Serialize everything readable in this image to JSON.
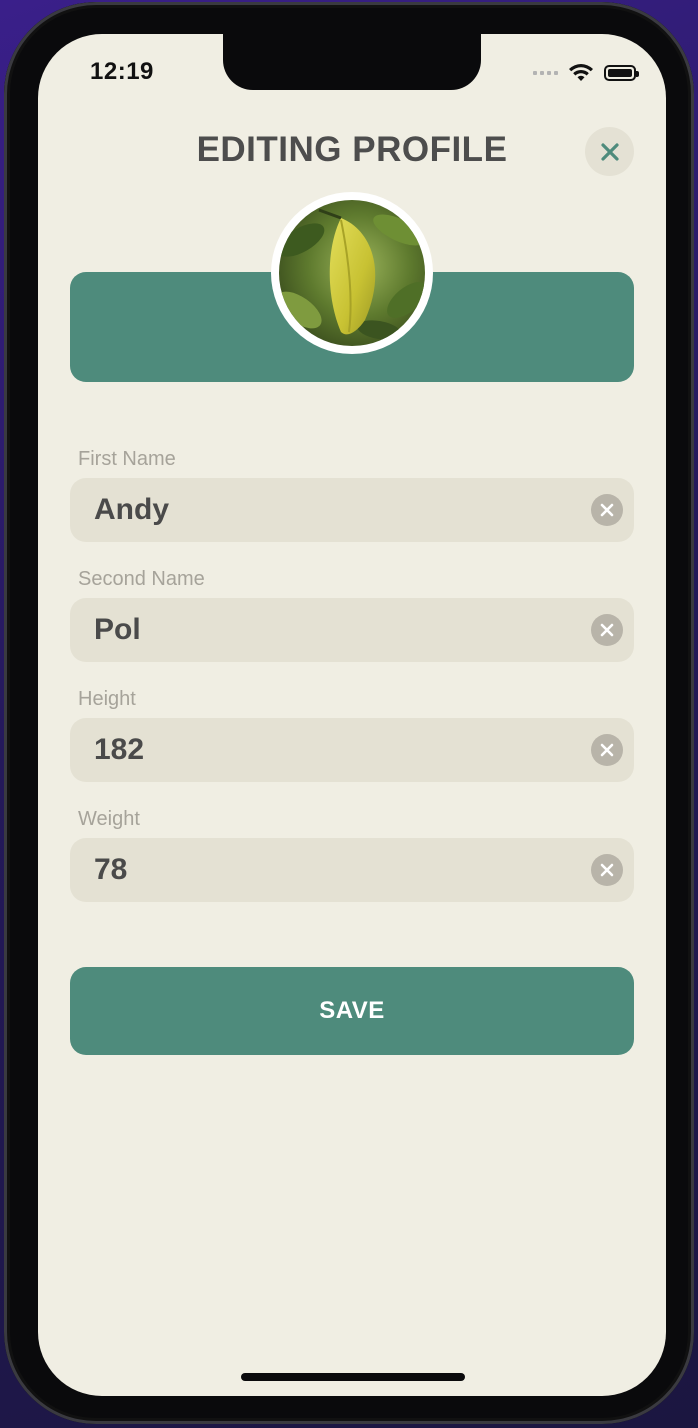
{
  "status_bar": {
    "time": "12:19"
  },
  "header": {
    "title": "EDITING PROFILE"
  },
  "colors": {
    "accent": "#4e8b7c",
    "background": "#f0eee3",
    "field_background": "#e4e1d3"
  },
  "fields": [
    {
      "label": "First Name",
      "value": "Andy"
    },
    {
      "label": "Second Name",
      "value": "Pol"
    },
    {
      "label": "Height",
      "value": "182"
    },
    {
      "label": "Weight",
      "value": "78"
    }
  ],
  "actions": {
    "save_label": "SAVE"
  }
}
